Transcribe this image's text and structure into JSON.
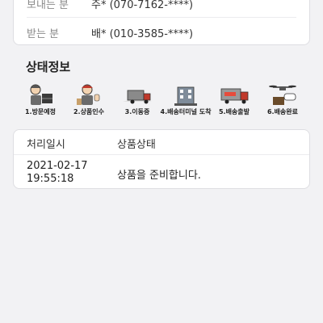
{
  "parties": [
    {
      "label": "보내는 분",
      "value": "주* (070-7162-****)"
    },
    {
      "label": "받는 분",
      "value": "배* (010-3585-****)"
    }
  ],
  "status_section": {
    "title": "상태정보",
    "steps": [
      {
        "caption": "1.방문예정",
        "icon": "delivery-worker-box-icon"
      },
      {
        "caption": "2.상품인수",
        "icon": "delivery-worker-thumbs-up-icon"
      },
      {
        "caption": "3.이동중",
        "icon": "moving-truck-icon"
      },
      {
        "caption": "4.배송터미널 도착",
        "icon": "terminal-building-icon"
      },
      {
        "caption": "5.배송출발",
        "icon": "departing-truck-icon"
      },
      {
        "caption": "6.배송완료",
        "icon": "drone-good-icon"
      }
    ]
  },
  "history": {
    "headers": {
      "time": "처리일시",
      "status": "상품상태"
    },
    "rows": [
      {
        "date": "2021-02-17",
        "time": "19:55:18",
        "status": "상품을 준비합니다."
      }
    ]
  }
}
